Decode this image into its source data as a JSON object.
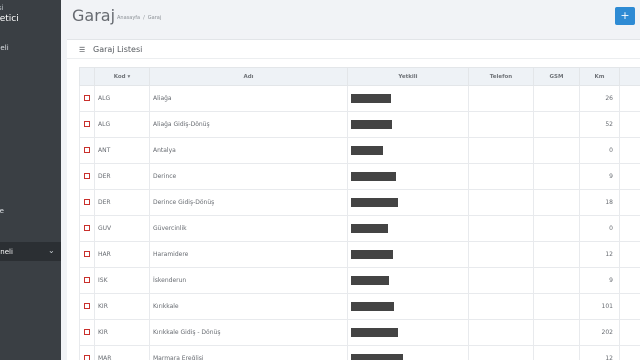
{
  "sidebar": {
    "role": "isi",
    "name": "netici",
    "sub": "i",
    "items": [
      "neli",
      "se"
    ],
    "active": "aneli"
  },
  "header": {
    "title": "Garaj",
    "breadcrumb": [
      "Anasayfa",
      "/",
      "Garaj"
    ],
    "add_icon": "plus-icon",
    "add_label": "+"
  },
  "panel": {
    "icon": "list-icon",
    "icon_glyph": "☰",
    "title": "Garaj Listesi"
  },
  "table": {
    "columns": [
      "",
      "Kod",
      "Adı",
      "Yetkili",
      "Telefon",
      "GSM",
      "Km"
    ],
    "sort_indicator": "▾",
    "rows": [
      {
        "kod": "ALG",
        "adi": "Aliağa",
        "yetkili_redacted": true,
        "telefon": "",
        "gsm": "",
        "km": "26"
      },
      {
        "kod": "ALG",
        "adi": "Aliağa Gidiş-Dönüş",
        "yetkili_redacted": true,
        "telefon": "",
        "gsm": "",
        "km": "52"
      },
      {
        "kod": "ANT",
        "adi": "Antalya",
        "yetkili_redacted": true,
        "telefon": "",
        "gsm": "",
        "km": "0"
      },
      {
        "kod": "DER",
        "adi": "Derince",
        "yetkili_redacted": true,
        "telefon": "",
        "gsm": "",
        "km": "9"
      },
      {
        "kod": "DER",
        "adi": "Derince Gidiş-Dönüş",
        "yetkili_redacted": true,
        "telefon": "",
        "gsm": "",
        "km": "18"
      },
      {
        "kod": "GUV",
        "adi": "Güvercinlik",
        "yetkili_redacted": true,
        "telefon": "",
        "gsm": "",
        "km": "0"
      },
      {
        "kod": "HAR",
        "adi": "Haramidere",
        "yetkili_redacted": true,
        "telefon": "",
        "gsm": "",
        "km": "12"
      },
      {
        "kod": "ISK",
        "adi": "İskenderun",
        "yetkili_redacted": true,
        "telefon": "",
        "gsm": "",
        "km": "9"
      },
      {
        "kod": "KIR",
        "adi": "Kırıkkale",
        "yetkili_redacted": true,
        "telefon": "",
        "gsm": "",
        "km": "101"
      },
      {
        "kod": "KIR",
        "adi": "Kırıkkale Gidiş - Dönüş",
        "yetkili_redacted": true,
        "telefon": "",
        "gsm": "",
        "km": "202"
      },
      {
        "kod": "MAR",
        "adi": "Marmara Ereğlisi",
        "yetkili_redacted": true,
        "telefon": "",
        "gsm": "",
        "km": "12"
      }
    ]
  }
}
